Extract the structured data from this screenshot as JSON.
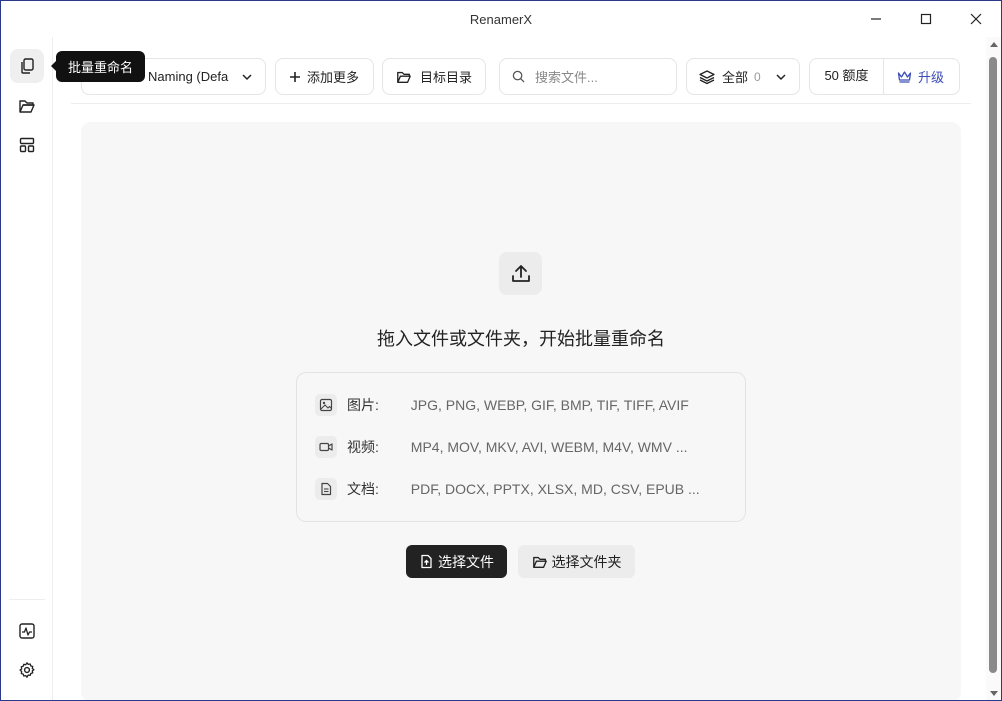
{
  "window": {
    "title": "RenamerX"
  },
  "tooltip": {
    "text": "批量重命名"
  },
  "sidebar": {
    "top_items": [
      {
        "icon": "copy-files-icon",
        "label": "批量重命名",
        "active": true
      },
      {
        "icon": "folder-open-icon"
      },
      {
        "icon": "layout-grid-icon"
      }
    ],
    "bottom_items": [
      {
        "icon": "activity-chart-icon"
      },
      {
        "icon": "gear-icon"
      }
    ]
  },
  "toolbar": {
    "preset_label": "Naming (Defa",
    "add_more_label": "添加更多",
    "target_dir_label": "目标目录",
    "search_placeholder": "搜索文件...",
    "filter_label": "全部",
    "filter_count": "0",
    "credits_label": "50 额度",
    "upgrade_label": "升级"
  },
  "main": {
    "drop_title": "拖入文件或文件夹，开始批量重命名",
    "formats": [
      {
        "icon": "image-icon",
        "label": "图片:",
        "value": "JPG, PNG, WEBP, GIF, BMP, TIF, TIFF, AVIF"
      },
      {
        "icon": "video-icon",
        "label": "视频:",
        "value": "MP4, MOV, MKV, AVI, WEBM, M4V, WMV ..."
      },
      {
        "icon": "document-icon",
        "label": "文档:",
        "value": "PDF, DOCX, PPTX, XLSX, MD, CSV, EPUB ..."
      }
    ],
    "select_files_label": "选择文件",
    "select_folder_label": "选择文件夹"
  },
  "colors": {
    "accent": "#222222",
    "upgrade": "#3b4db8",
    "window_border": "#2a3a8a"
  }
}
